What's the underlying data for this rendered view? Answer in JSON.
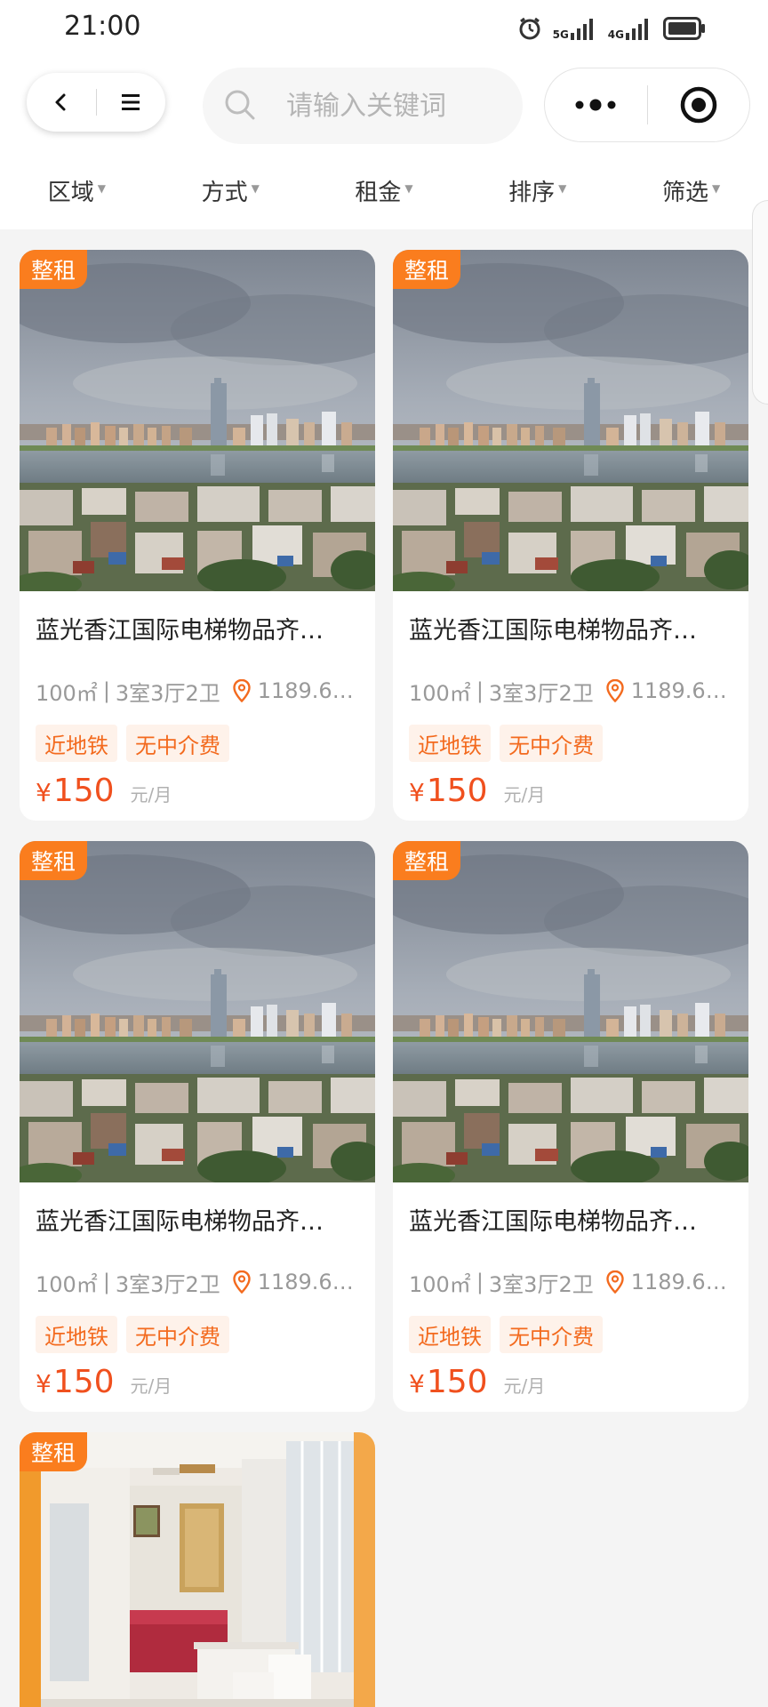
{
  "status_bar": {
    "time": "21:00",
    "net_1": "5G",
    "net_2": "4G"
  },
  "nav": {
    "search_placeholder": "请输入关键词"
  },
  "filters": [
    {
      "label": "区域"
    },
    {
      "label": "方式"
    },
    {
      "label": "租金"
    },
    {
      "label": "排序"
    },
    {
      "label": "筛选"
    }
  ],
  "listings": [
    {
      "badge": "整租",
      "title": "蓝光香江国际电梯物品齐…",
      "area": "100㎡",
      "layout": "3室3厅2卫",
      "distance": "1189.6…",
      "tags": [
        "近地铁",
        "无中介费"
      ],
      "currency": "¥",
      "price": "150",
      "price_unit": "元/月"
    },
    {
      "badge": "整租",
      "title": "蓝光香江国际电梯物品齐…",
      "area": "100㎡",
      "layout": "3室3厅2卫",
      "distance": "1189.6…",
      "tags": [
        "近地铁",
        "无中介费"
      ],
      "currency": "¥",
      "price": "150",
      "price_unit": "元/月"
    },
    {
      "badge": "整租",
      "title": "蓝光香江国际电梯物品齐…",
      "area": "100㎡",
      "layout": "3室3厅2卫",
      "distance": "1189.6…",
      "tags": [
        "近地铁",
        "无中介费"
      ],
      "currency": "¥",
      "price": "150",
      "price_unit": "元/月"
    },
    {
      "badge": "整租",
      "title": "蓝光香江国际电梯物品齐…",
      "area": "100㎡",
      "layout": "3室3厅2卫",
      "distance": "1189.6…",
      "tags": [
        "近地铁",
        "无中介费"
      ],
      "currency": "¥",
      "price": "150",
      "price_unit": "元/月"
    },
    {
      "badge": "整租"
    }
  ],
  "colors": {
    "accent": "#fa7d1e",
    "price": "#f0501e",
    "tag_bg": "#fef2ea",
    "page_bg": "#f4f4f4"
  },
  "icons": [
    "back-arrow-icon",
    "menu-icon",
    "search-icon",
    "more-dots-icon",
    "target-icon",
    "location-pin-icon",
    "alarm-icon",
    "signal-icon",
    "battery-icon"
  ]
}
